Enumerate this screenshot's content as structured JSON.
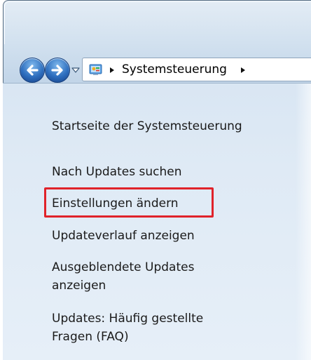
{
  "window": {
    "title": ""
  },
  "navigation": {
    "back_icon": "back-arrow-icon",
    "forward_icon": "forward-arrow-icon",
    "history_icon": "chevron-down-icon"
  },
  "address_bar": {
    "location_icon": "control-panel-icon",
    "breadcrumbs": [
      "Systemsteuerung"
    ]
  },
  "sidebar": {
    "home_link": "Startseite der Systemsteuerung",
    "links": [
      {
        "label": "Nach Updates suchen"
      },
      {
        "label": "Einstellungen ändern",
        "highlighted": true
      },
      {
        "label": "Updateverlauf anzeigen"
      },
      {
        "label_line1": "Ausgeblendete Updates",
        "label_line2": "anzeigen"
      },
      {
        "label_line1": "Updates: Häufig gestellte",
        "label_line2": "Fragen (FAQ)"
      }
    ]
  },
  "colors": {
    "highlight_border": "#e0222a",
    "nav_button": "#2e6fbf"
  }
}
